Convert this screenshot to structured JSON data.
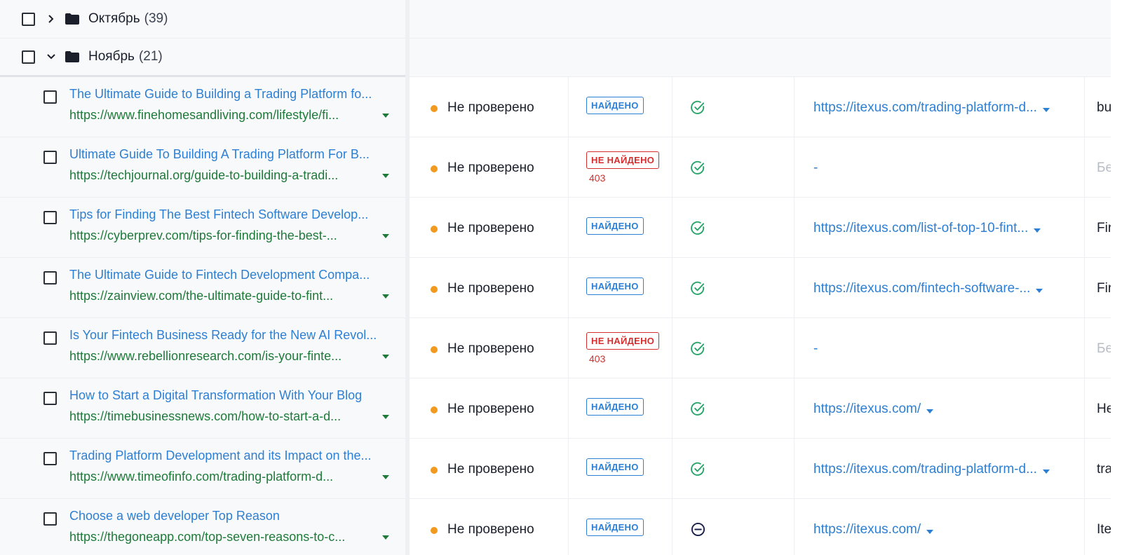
{
  "folders": [
    {
      "name": "Октябрь",
      "count": "(39)",
      "expanded": false
    },
    {
      "name": "Ноябрь",
      "count": "(21)",
      "expanded": true
    }
  ],
  "colors": {
    "link": "#2d7fd3",
    "source_url": "#1f7a3a",
    "status_dot": "#f29a1f",
    "not_found": "#d42f2f",
    "check": "#2aa56a"
  },
  "rows": [
    {
      "title": "The Ultimate Guide to Building a Trading Platform fo...",
      "url": "https://www.finehomesandliving.com/lifestyle/fi...",
      "status": "Не проверено",
      "badge": "НАЙДЕНО",
      "badge_type": "found",
      "code": "",
      "check": "ok",
      "target": "https://itexus.com/trading-platform-d...",
      "anchor": "bu"
    },
    {
      "title": "Ultimate Guide To Building A Trading Platform For B...",
      "url": "https://techjournal.org/guide-to-building-a-tradi...",
      "status": "Не проверено",
      "badge": "НЕ НАЙДЕНО",
      "badge_type": "notfound",
      "code": "403",
      "check": "ok",
      "target": "-",
      "anchor": "Бе"
    },
    {
      "title": "Tips for Finding The Best Fintech Software Develop...",
      "url": "https://cyberprev.com/tips-for-finding-the-best-...",
      "status": "Не проверено",
      "badge": "НАЙДЕНО",
      "badge_type": "found",
      "code": "",
      "check": "ok",
      "target": "https://itexus.com/list-of-top-10-fint...",
      "anchor": "Fir"
    },
    {
      "title": "The Ultimate Guide to Fintech Development Compa...",
      "url": "https://zainview.com/the-ultimate-guide-to-fint...",
      "status": "Не проверено",
      "badge": "НАЙДЕНО",
      "badge_type": "found",
      "code": "",
      "check": "ok",
      "target": "https://itexus.com/fintech-software-...",
      "anchor": "Fir"
    },
    {
      "title": "Is Your Fintech Business Ready for the New AI Revol...",
      "url": "https://www.rebellionresearch.com/is-your-finte...",
      "status": "Не проверено",
      "badge": "НЕ НАЙДЕНО",
      "badge_type": "notfound",
      "code": "403",
      "check": "ok",
      "target": "-",
      "anchor": "Бе"
    },
    {
      "title": "How to Start a Digital Transformation With Your Blog",
      "url": "https://timebusinessnews.com/how-to-start-a-d...",
      "status": "Не проверено",
      "badge": "НАЙДЕНО",
      "badge_type": "found",
      "code": "",
      "check": "ok",
      "target": "https://itexus.com/",
      "anchor": "He"
    },
    {
      "title": "Trading Platform Development and its Impact on the...",
      "url": "https://www.timeofinfo.com/trading-platform-d...",
      "status": "Не проверено",
      "badge": "НАЙДЕНО",
      "badge_type": "found",
      "code": "",
      "check": "ok",
      "target": "https://itexus.com/trading-platform-d...",
      "anchor": "tra"
    },
    {
      "title": "Choose a web developer Top Reason",
      "url": "https://thegoneapp.com/top-seven-reasons-to-c...",
      "status": "Не проверено",
      "badge": "НАЙДЕНО",
      "badge_type": "found",
      "code": "",
      "check": "neutral",
      "target": "https://itexus.com/",
      "anchor": "Ite"
    }
  ]
}
